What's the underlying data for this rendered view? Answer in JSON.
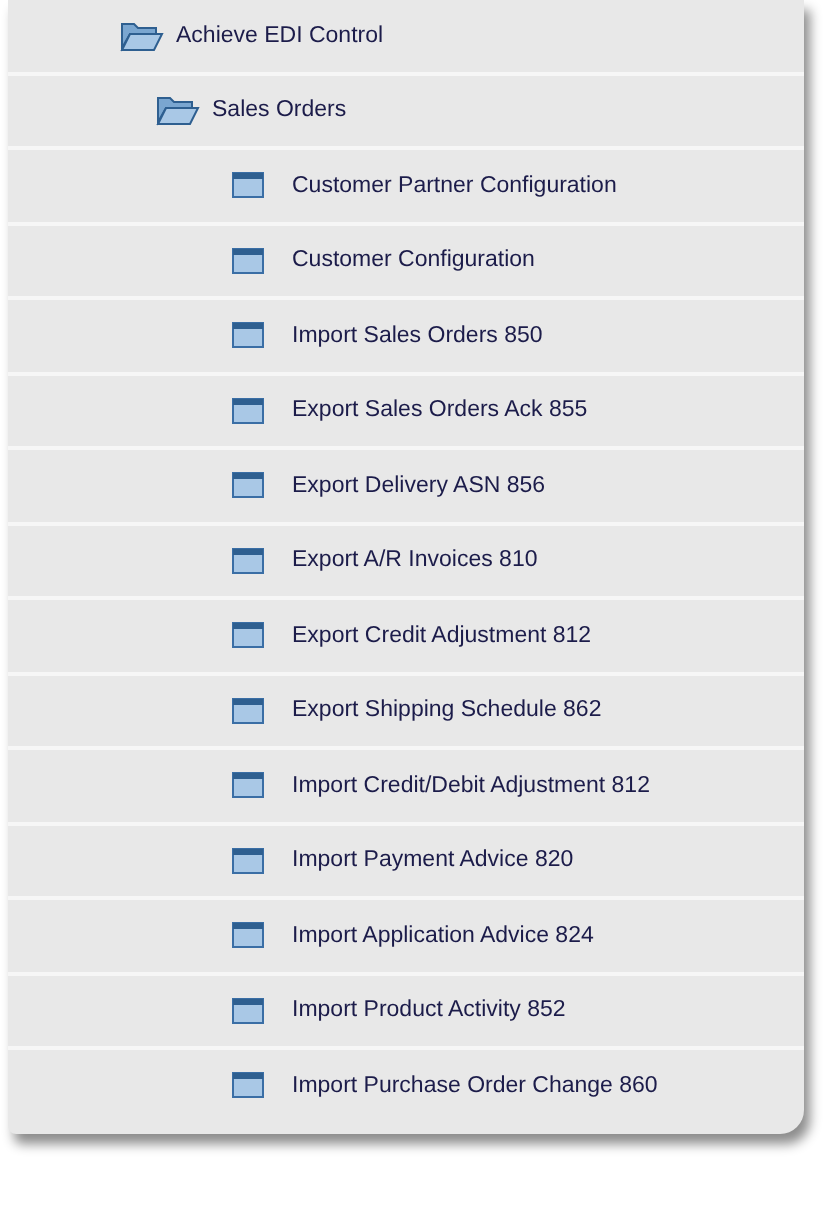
{
  "tree": [
    {
      "label": "Achieve EDI Control",
      "kind": "folder",
      "expanded": true,
      "children": [
        {
          "label": "Sales Orders",
          "kind": "folder",
          "expanded": true,
          "children": [
            {
              "label": "Customer Partner Configuration",
              "kind": "form"
            },
            {
              "label": "Customer Configuration",
              "kind": "form"
            },
            {
              "label": "Import Sales Orders 850",
              "kind": "form"
            },
            {
              "label": "Export Sales Orders Ack 855",
              "kind": "form"
            },
            {
              "label": "Export Delivery ASN 856",
              "kind": "form"
            },
            {
              "label": "Export A/R Invoices 810",
              "kind": "form"
            },
            {
              "label": "Export Credit Adjustment 812",
              "kind": "form"
            },
            {
              "label": "Export Shipping Schedule 862",
              "kind": "form"
            },
            {
              "label": "Import Credit/Debit Adjustment 812",
              "kind": "form"
            },
            {
              "label": "Import Payment Advice 820",
              "kind": "form"
            },
            {
              "label": "Import Application Advice 824",
              "kind": "form"
            },
            {
              "label": "Import Product Activity 852",
              "kind": "form"
            },
            {
              "label": "Import Purchase Order Change 860",
              "kind": "form"
            }
          ]
        }
      ]
    }
  ]
}
